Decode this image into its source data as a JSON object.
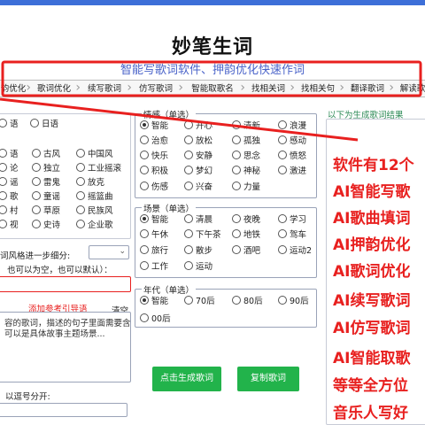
{
  "header": {
    "title": "妙笔生词",
    "subtitle": "智能写歌词软件、押韵优化快速作词"
  },
  "tabs": [
    {
      "label": "韵优化"
    },
    {
      "label": "歌词优化"
    },
    {
      "label": "续写歌词"
    },
    {
      "label": "仿写歌词"
    },
    {
      "label": "智能取歌名"
    },
    {
      "label": "找相关词"
    },
    {
      "label": "找相关句"
    },
    {
      "label": "翻译歌词"
    },
    {
      "label": "解读歌"
    }
  ],
  "left": {
    "language": [
      {
        "label": "语",
        "checked": false
      },
      {
        "label": "日语",
        "checked": false
      }
    ],
    "styles": [
      [
        {
          "label": "语"
        },
        {
          "label": "古风"
        },
        {
          "label": "中国风"
        }
      ],
      [
        {
          "label": "论"
        },
        {
          "label": "独立"
        },
        {
          "label": "工业摇滚"
        }
      ],
      [
        {
          "label": "谣"
        },
        {
          "label": "雷鬼"
        },
        {
          "label": "放克"
        }
      ],
      [
        {
          "label": "歌"
        },
        {
          "label": "童谣"
        },
        {
          "label": "摇篮曲"
        }
      ],
      [
        {
          "label": "村"
        },
        {
          "label": "草原"
        },
        {
          "label": "民族风"
        }
      ],
      [
        {
          "label": "视"
        },
        {
          "label": "史诗"
        },
        {
          "label": "企业歌"
        }
      ]
    ],
    "refine_label": "词风格进一步细分:",
    "refine_hint": "也可以为空，也可以默认）：",
    "add_link": "添加参考引导语",
    "clear_label": "清空",
    "textarea_line1": "容的歌词，描述的句子里面需要含",
    "textarea_line2": "可以是具体故事主题场景...",
    "comma_hint": "以逗号分开:"
  },
  "mood": {
    "legend": "情感（单选）",
    "rows": [
      [
        {
          "label": "智能",
          "checked": true
        },
        {
          "label": "开心"
        },
        {
          "label": "清新"
        },
        {
          "label": "浪漫"
        }
      ],
      [
        {
          "label": "治愈"
        },
        {
          "label": "放松"
        },
        {
          "label": "孤独"
        },
        {
          "label": "感动"
        }
      ],
      [
        {
          "label": "快乐"
        },
        {
          "label": "安静"
        },
        {
          "label": "思念"
        },
        {
          "label": "愤怒"
        }
      ],
      [
        {
          "label": "积极"
        },
        {
          "label": "梦幻"
        },
        {
          "label": "神秘"
        },
        {
          "label": "激进"
        }
      ],
      [
        {
          "label": "伤感"
        },
        {
          "label": "兴奋"
        },
        {
          "label": "力量"
        }
      ]
    ]
  },
  "scene": {
    "legend": "场景（单选）",
    "rows": [
      [
        {
          "label": "智能",
          "checked": true
        },
        {
          "label": "清晨"
        },
        {
          "label": "夜晚"
        },
        {
          "label": "学习"
        }
      ],
      [
        {
          "label": "午休"
        },
        {
          "label": "下午茶"
        },
        {
          "label": "地铁"
        },
        {
          "label": "驾车"
        }
      ],
      [
        {
          "label": "旅行"
        },
        {
          "label": "散步"
        },
        {
          "label": "酒吧"
        },
        {
          "label": "运动2"
        }
      ],
      [
        {
          "label": "工作"
        },
        {
          "label": "运动"
        }
      ]
    ]
  },
  "era": {
    "legend": "年代（单选）",
    "rows": [
      [
        {
          "label": "智能",
          "checked": true
        },
        {
          "label": "70后"
        },
        {
          "label": "80后"
        },
        {
          "label": "90后"
        }
      ],
      [
        {
          "label": "00后"
        }
      ]
    ]
  },
  "buttons": {
    "generate": "点击生成歌词",
    "copy": "复制歌词"
  },
  "right": {
    "result_hint": "以下为生成歌词结果",
    "promo_lines": [
      "软件有12个",
      "AI智能写歌",
      "AI歌曲填词",
      "AI押韵优化",
      "AI歌词优化",
      "AI续写歌词",
      "AI仿写歌词",
      "AI智能取歌",
      "等等全方位",
      "音乐人写好"
    ]
  },
  "colors": {
    "accent": "#3d6fd8",
    "annotation": "#e8201f",
    "button": "#22b34b"
  }
}
